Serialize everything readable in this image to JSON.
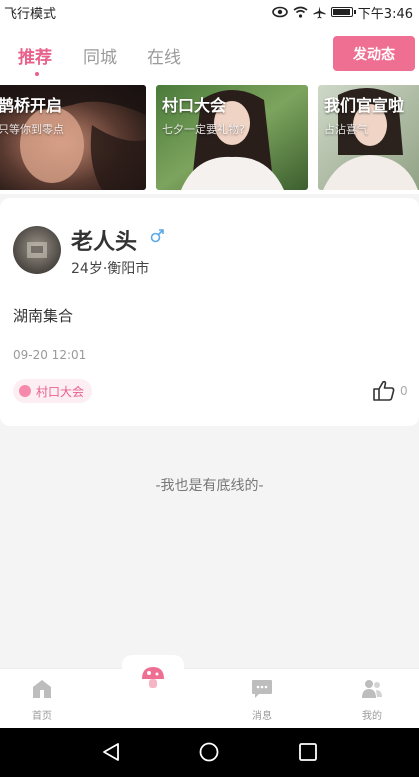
{
  "status_bar": {
    "left_text": "飞行模式",
    "time": "下午3:46"
  },
  "header": {
    "tabs": [
      {
        "label": "推荐",
        "active": true
      },
      {
        "label": "同城",
        "active": false
      },
      {
        "label": "在线",
        "active": false
      }
    ],
    "post_button": "发动态"
  },
  "banners": [
    {
      "title": "鹊桥开启",
      "subtitle": "只等你到零点"
    },
    {
      "title": "村口大会",
      "subtitle": "七夕一定要礼物?"
    },
    {
      "title": "我们官宣啦",
      "subtitle": "占沾喜气"
    }
  ],
  "post": {
    "username": "老人头",
    "gender": "♂",
    "meta": "24岁·衡阳市",
    "content": "湖南集合",
    "time": "09-20 12:01",
    "tag": "村口大会",
    "likes": "0"
  },
  "end_text": "-我也是有底线的-",
  "tabbar": {
    "home": "首页",
    "messages": "消息",
    "mine": "我的"
  },
  "colors": {
    "accent": "#e8618c",
    "button": "#ef6f93",
    "tag_bg": "#fdeef3"
  }
}
